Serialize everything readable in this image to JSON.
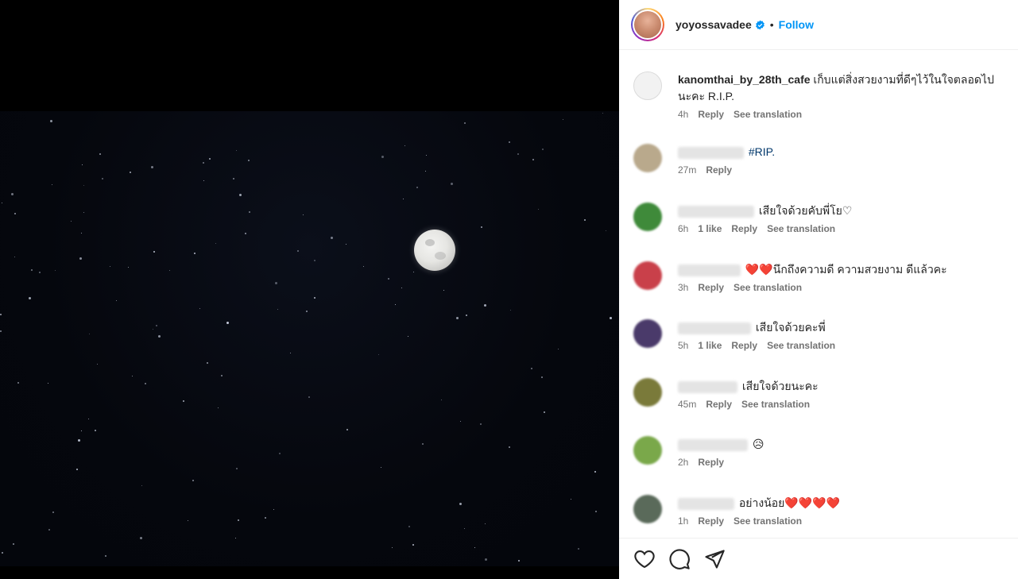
{
  "post": {
    "owner": {
      "username": "yoyossavadee",
      "verified": true,
      "follow_label": "Follow",
      "separator": "•"
    }
  },
  "comments": [
    {
      "username": "kanomthai_by_28th_cafe",
      "blurred": false,
      "text": "เก็บแต่สิ่งสวยงามที่ดีๆไว้ในใจตลอดไปนะคะ R.I.P.",
      "time": "4h",
      "likes": "",
      "reply_label": "Reply",
      "translate_label": "See translation",
      "avatar_color": "#f2f2f2"
    },
    {
      "username": "",
      "blurred": true,
      "text": "#RIP.",
      "time": "27m",
      "likes": "",
      "reply_label": "Reply",
      "translate_label": "",
      "avatar_color": "#b9a98c"
    },
    {
      "username": "",
      "blurred": true,
      "text": "เสียใจด้วยคับพี่โย♡",
      "time": "6h",
      "likes": "1 like",
      "reply_label": "Reply",
      "translate_label": "See translation",
      "avatar_color": "#3f8a3a"
    },
    {
      "username": "",
      "blurred": true,
      "text": "❤️❤️นึกถึงความดี ความสวยงาม ดีแล้วคะ",
      "time": "3h",
      "likes": "",
      "reply_label": "Reply",
      "translate_label": "See translation",
      "avatar_color": "#c9404a"
    },
    {
      "username": "",
      "blurred": true,
      "text": "เสียใจด้วยคะพี่",
      "time": "5h",
      "likes": "1 like",
      "reply_label": "Reply",
      "translate_label": "See translation",
      "avatar_color": "#4a3a6a"
    },
    {
      "username": "",
      "blurred": true,
      "text": "เสียใจด้วยนะคะ",
      "time": "45m",
      "likes": "",
      "reply_label": "Reply",
      "translate_label": "See translation",
      "avatar_color": "#7a7a3a"
    },
    {
      "username": "",
      "blurred": true,
      "text": "😥",
      "time": "2h",
      "likes": "",
      "reply_label": "Reply",
      "translate_label": "",
      "avatar_color": "#7aa84a"
    },
    {
      "username": "",
      "blurred": true,
      "text": "อย่างน้อย❤️❤️❤️❤️",
      "time": "1h",
      "likes": "",
      "reply_label": "Reply",
      "translate_label": "See translation",
      "avatar_color": "#5a6a5a"
    }
  ],
  "actions": {
    "like_icon": "heart-icon",
    "comment_icon": "comment-icon",
    "share_icon": "share-icon"
  },
  "colors": {
    "accent": "#0095f6",
    "verified": "#0095f6",
    "meta_text": "#737373"
  }
}
